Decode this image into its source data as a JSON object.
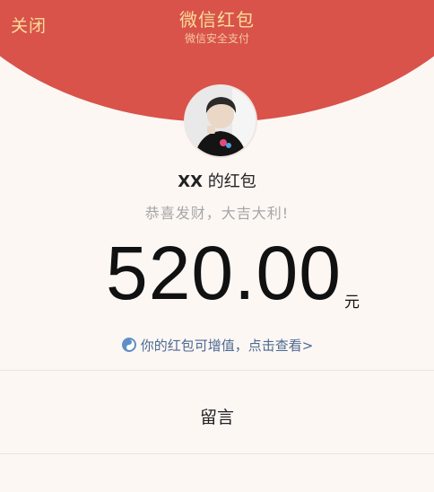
{
  "header": {
    "close_label": "关闭",
    "title": "微信红包",
    "subtitle": "微信安全支付",
    "color": "#d9534a",
    "text_color": "#f8dd9a"
  },
  "sender": {
    "name": "XX",
    "suffix": "的红包",
    "avatar_icon": "user-avatar"
  },
  "wish": "恭喜发财，大吉大利!",
  "amount": {
    "value": "520.00",
    "unit": "元"
  },
  "value_link": {
    "icon": "wallet-icon",
    "text": "你的红包可增值，点击查看>"
  },
  "message_button": {
    "label": "留言"
  }
}
